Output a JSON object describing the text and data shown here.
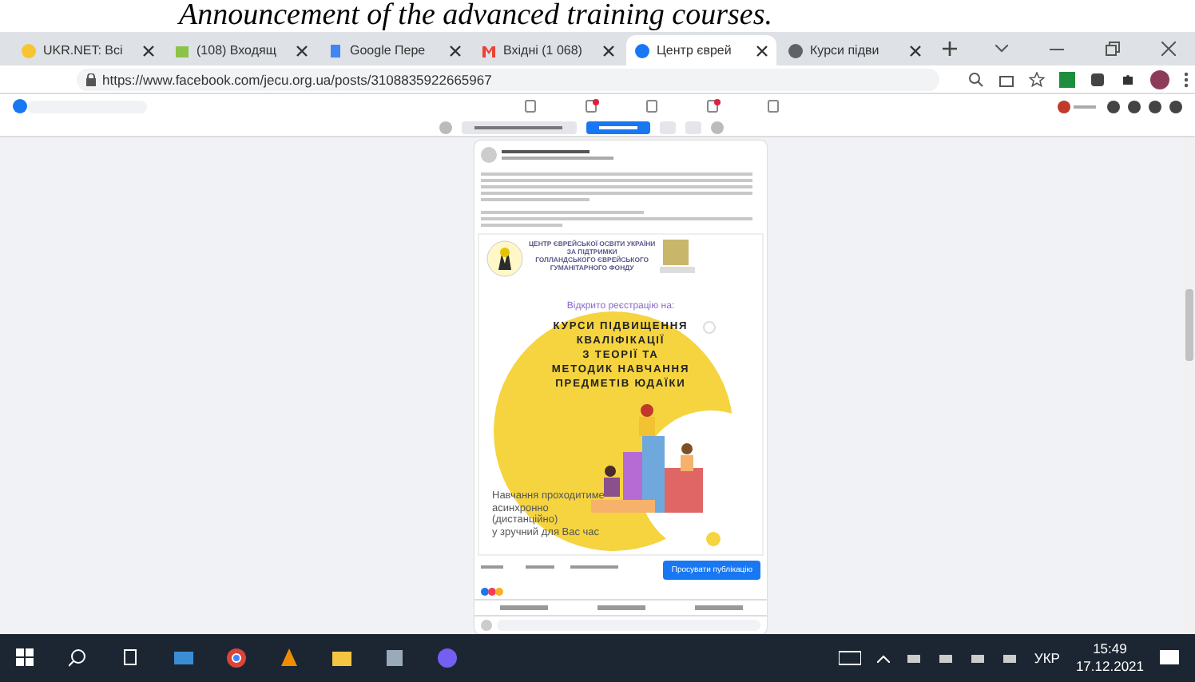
{
  "caption": "Announcement of the advanced training courses.",
  "tabs": [
    {
      "label": "UKR.NET: Всі",
      "selected": false
    },
    {
      "label": "(108) Входящ",
      "selected": false
    },
    {
      "label": "Google Пере",
      "selected": false
    },
    {
      "label": "Вхідні (1 068)",
      "selected": false
    },
    {
      "label": "Центр єврей",
      "selected": true
    },
    {
      "label": "Курси підви",
      "selected": false
    }
  ],
  "address": "https://www.facebook.com/jecu.org.ua/posts/3108835922665967",
  "post": {
    "poster": {
      "org_lines": [
        "ЦЕНТР ЄВРЕЙСЬКОЇ ОСВІТИ УКРАЇНИ",
        "ЗА ПІДТРИМКИ",
        "ГОЛЛАНДСЬКОГО ЄВРЕЙСЬКОГО",
        "ГУМАНІТАРНОГО ФОНДУ"
      ],
      "registration": "Відкрито реєстрацію на:",
      "title_lines": [
        "КУРСИ ПІДВИЩЕННЯ",
        "КВАЛІФІКАЦІЇ",
        "З ТЕОРІЇ ТА",
        "МЕТОДИК НАВЧАННЯ",
        "ПРЕДМЕТІВ ЮДАЇКИ"
      ],
      "note_lines": [
        "Навчання проходитиме",
        "асинхронно",
        "(дистанційно)",
        "у зручний для Вас час"
      ]
    },
    "promote_button": "Просувати публікацію"
  },
  "taskbar": {
    "language": "УКР",
    "time": "15:49",
    "date": "17.12.2021"
  }
}
